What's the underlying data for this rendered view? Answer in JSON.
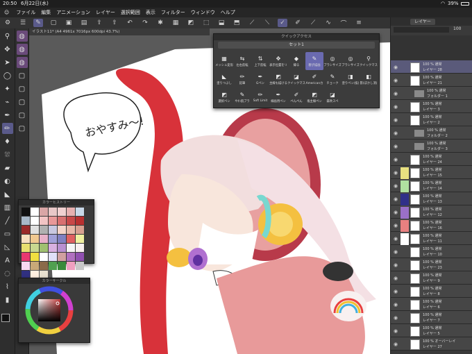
{
  "status": {
    "time": "20:50",
    "date": "6月22日(水)",
    "battery": "39%"
  },
  "menu": [
    "ファイル",
    "編集",
    "アニメーション",
    "レイヤー",
    "選択範囲",
    "表示",
    "フィルター",
    "ウィンドウ",
    "ヘルプ"
  ],
  "document_tab": "イラスト11* (A4 4961x 7016px 600dpi 43.7%)",
  "speech_text": "おやすみ〜!",
  "quick_access": {
    "title": "クイックアクセス",
    "set": "セット1",
    "items": [
      {
        "label": "メッシュ変形",
        "icon": "▦"
      },
      {
        "label": "左右反転",
        "icon": "⇆"
      },
      {
        "label": "上下反転",
        "icon": "⇅"
      },
      {
        "label": "表示位置をリ",
        "icon": "✥"
      },
      {
        "label": "縁る",
        "icon": "◆"
      },
      {
        "label": "親子描画",
        "icon": "✎"
      },
      {
        "label": "ブラシサイズ",
        "icon": "◎"
      },
      {
        "label": "ブラシサイズ",
        "icon": "◎"
      },
      {
        "label": "クイックマス",
        "icon": "⚲"
      },
      {
        "label": "塗りつぶし",
        "icon": "◣"
      },
      {
        "label": "鉛筆",
        "icon": "✏"
      },
      {
        "label": "Gペン",
        "icon": "✒"
      },
      {
        "label": "主線も描ける",
        "icon": "◩"
      },
      {
        "label": "クイックマス",
        "icon": "◪"
      },
      {
        "label": "Americanカ",
        "icon": "✐"
      },
      {
        "label": "チョーク",
        "icon": "✎"
      },
      {
        "label": "塗りペン(抜)",
        "icon": "◨"
      },
      {
        "label": "影(ぼかし消)",
        "icon": "◧"
      },
      {
        "label": "選択ペン",
        "icon": "◩"
      },
      {
        "label": "やわ肌ブラ",
        "icon": "✎"
      },
      {
        "label": "Soft Limit",
        "icon": "✏"
      },
      {
        "label": "線画用ペン",
        "icon": "✒"
      },
      {
        "label": "ぺんぺん",
        "icon": "✐"
      },
      {
        "label": "塩主線ぺン",
        "icon": "◩"
      },
      {
        "label": "霧吹スペ",
        "icon": "◪"
      }
    ]
  },
  "color_history": {
    "title": "カラーヒストリー",
    "colors": [
      "#111111",
      "#ffffff",
      "#d9a6a6",
      "#e8c8c8",
      "#f0d0d0",
      "#e6b0b0",
      "#c8d8e8",
      "#a8b8c8",
      "#ffffff",
      "#f2c4c4",
      "#e89898",
      "#d87070",
      "#c84848",
      "#b83030",
      "#9a2a2a",
      "#e0e0e0",
      "#b0b0b0",
      "#c8c8e0",
      "#f4d4c8",
      "#e8b8a8",
      "#d8a090",
      "#f8e0c0",
      "#f0c890",
      "#e8b0c8",
      "#a0a0d8",
      "#8080c0",
      "#e06060",
      "#f0f0a0",
      "#e8e070",
      "#c8d890",
      "#a0c070",
      "#d8b0e0",
      "#b890d0",
      "#f5f5f5",
      "#f8f0f0",
      "#e83870",
      "#f0e040",
      "#ffffff",
      "#e0e0f8",
      "#d0a0a0",
      "#b070c0",
      "#9050b0",
      "#f8d8f0",
      "#c8a878",
      "#8a6a4a",
      "#50a050",
      "#3a8a3a",
      "#f0a0c0",
      "#c8c8c8",
      "#303080",
      "#fff0e0",
      "#e8e0d0"
    ]
  },
  "color_wheel": {
    "title": "カラーサークル",
    "main": "#c23a3a"
  },
  "panel": {
    "tab": "レイヤー",
    "opacity": "100"
  },
  "layers": [
    {
      "t1": "100 % 通常",
      "t2": "レイヤー 28",
      "sel": true,
      "label": ""
    },
    {
      "t1": "100 % 通常",
      "t2": "レイヤー 21",
      "label": ""
    },
    {
      "t1": "100 % 通常",
      "t2": "フォルダー 1",
      "folder": true,
      "label": ""
    },
    {
      "t1": "100 % 通常",
      "t2": "レイヤー 3",
      "label": ""
    },
    {
      "t1": "100 % 通常",
      "t2": "レイヤー 2",
      "label": ""
    },
    {
      "t1": "100 % 通常",
      "t2": "フォルダー 2",
      "folder": true,
      "label": ""
    },
    {
      "t1": "100 % 通常",
      "t2": "フォルダー 3",
      "folder": true,
      "label": ""
    },
    {
      "t1": "100 % 通常",
      "t2": "レイヤー 24",
      "label": ""
    },
    {
      "t1": "100 % 通常",
      "t2": "レイヤー 15",
      "label": "#e8e080"
    },
    {
      "t1": "100 % 通常",
      "t2": "レイヤー 14",
      "label": "#b0e0a0"
    },
    {
      "t1": "100 % 通常",
      "t2": "レイヤー 13",
      "label": "#303088"
    },
    {
      "t1": "100 % 通常",
      "t2": "レイヤー 12",
      "label": "#9a70c8"
    },
    {
      "t1": "100 % 通常",
      "t2": "レイヤー 16",
      "label": "#e88080"
    },
    {
      "t1": "100 % 通常",
      "t2": "レイヤー 11",
      "label": "#ffffff"
    },
    {
      "t1": "100 % 通常",
      "t2": "レイヤー 10",
      "label": ""
    },
    {
      "t1": "100 % 通常",
      "t2": "レイヤー 23",
      "label": ""
    },
    {
      "t1": "100 % 通常",
      "t2": "レイヤー 9",
      "label": ""
    },
    {
      "t1": "100 % 通常",
      "t2": "レイヤー 8",
      "label": ""
    },
    {
      "t1": "100 % 通常",
      "t2": "レイヤー 6",
      "label": ""
    },
    {
      "t1": "100 % 通常",
      "t2": "レイヤー 7",
      "label": ""
    },
    {
      "t1": "100 % 通常",
      "t2": "レイヤー 5",
      "label": ""
    },
    {
      "t1": "100 % オーバーレイ",
      "t2": "レイヤー 27",
      "label": ""
    }
  ]
}
